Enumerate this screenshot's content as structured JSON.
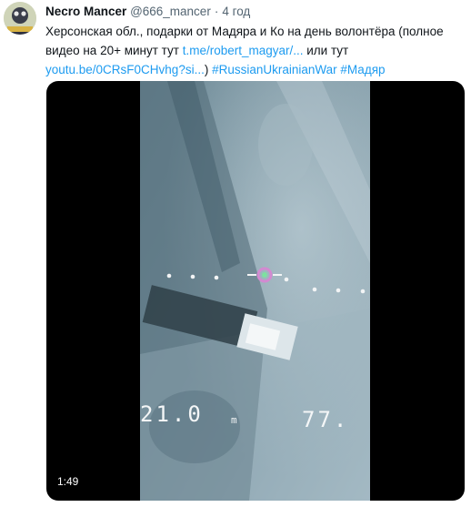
{
  "tweet": {
    "author_name": "Necro Mancer",
    "author_handle": "@666_mancer",
    "separator": "·",
    "time": "4 год",
    "text_line1": "Херсонская обл., подарки от Мадяра и Ко на день волонтёра (полное видео на 20+ минут тут ",
    "link1": "t.me/robert_magyar/...",
    "text_mid": " или тут",
    "link2": "youtu.be/0CRsF0CHvhg?si...",
    "text_after_link2": ") ",
    "hashtag1": "#RussianUkrainianWar",
    "hashtag2": "#Мадяр"
  },
  "video": {
    "duration": "1:49",
    "osd_left": "21.0",
    "osd_left_unit": "m",
    "osd_right": "77."
  },
  "colors": {
    "link": "#1d9bf0",
    "muted": "#536471",
    "video_bg": "#000000"
  }
}
